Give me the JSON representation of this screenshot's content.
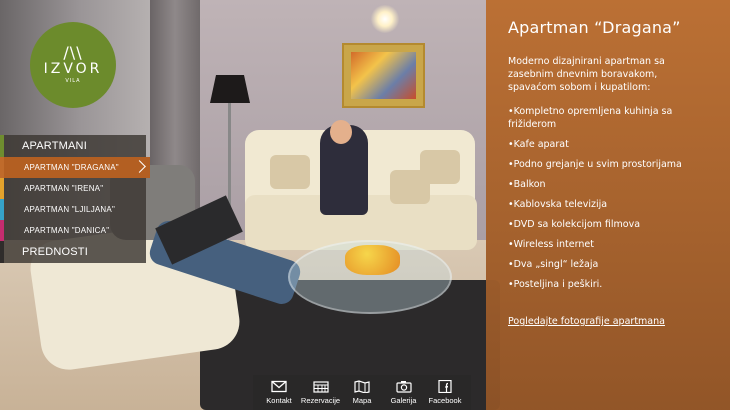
{
  "logo": {
    "mark": "/\\\\",
    "name": "IZVOR",
    "sub": "VILA"
  },
  "menu": {
    "items": [
      {
        "label": "APARTMANI"
      },
      {
        "label": "APARTMAN \"DRAGANA\""
      },
      {
        "label": "APARTMAN \"IRENA\""
      },
      {
        "label": "APARTMAN \"LJILJANA\""
      },
      {
        "label": "APARTMAN \"DANICA\""
      },
      {
        "label": "PREDNOSTI"
      }
    ]
  },
  "panel": {
    "title": "Apartman “Dragana”",
    "intro": "Moderno dizajnirani  apartman sa zasebnim dnevnim boravakom, spavaćom sobom i kupatilom:",
    "features": [
      "•Kompletno opremljena kuhinja sa frižiderom",
      "•Kafe aparat",
      "•Podno grejanje u svim prostorijama",
      "•Balkon",
      "•Kablovska televizija",
      "•DVD sa kolekcijom filmova",
      "•Wireless internet",
      "•Dva „singl“ ležaja",
      "•Posteljina i peškiri."
    ],
    "link": "Pogledajte fotografije apartmana"
  },
  "bottom_nav": {
    "items": [
      {
        "label": "Kontakt",
        "icon": "envelope-icon"
      },
      {
        "label": "Rezervacije",
        "icon": "calendar-icon"
      },
      {
        "label": "Mapa",
        "icon": "map-icon"
      },
      {
        "label": "Galerija",
        "icon": "camera-icon"
      },
      {
        "label": "Facebook",
        "icon": "facebook-icon"
      }
    ]
  },
  "colors": {
    "logo_green": "#6c8b2c",
    "panel_orange": "#c07234",
    "menu_dragana": "#b35f22",
    "menu_irena": "#e3a22c",
    "menu_ljiljana": "#36a2c8",
    "menu_danica": "#c42c6f"
  }
}
